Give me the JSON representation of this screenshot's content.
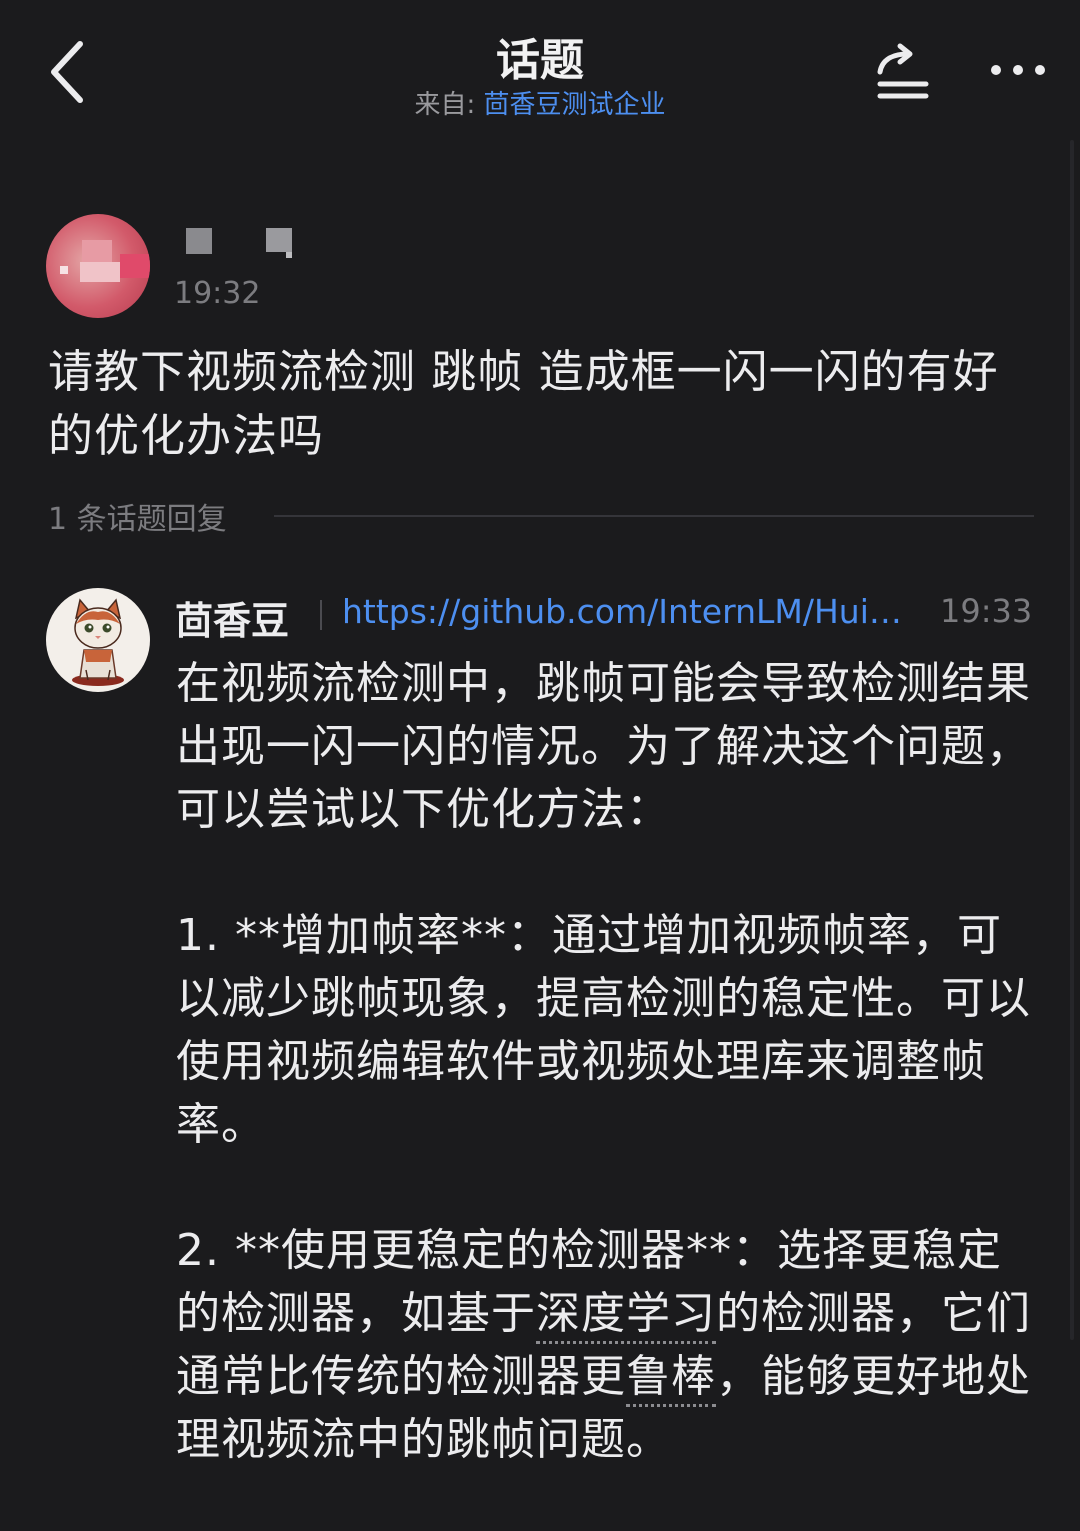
{
  "header": {
    "title": "话题",
    "source_label": "来自: ",
    "source_org": "茴香豆测试企业"
  },
  "post": {
    "time": "19:32",
    "text": "请教下视频流检测 跳帧  造成框一闪一闪的有好的优化办法吗"
  },
  "reply_count": "1 条话题回复",
  "reply": {
    "author": "茴香豆",
    "link": "https://github.com/InternLM/Huixiangdou",
    "time": "19:33",
    "paragraphs": {
      "p1": "在视频流检测中，跳帧可能会导致检测结果出现一闪一闪的情况。为了解决这个问题，可以尝试以下优化方法：",
      "p2": "1. **增加帧率**：通过增加视频帧率，可以减少跳帧现象，提高检测的稳定性。可以使用视频编辑软件或视频处理库来调整帧率。",
      "p3_a": "2. **使用更稳定的检测器**：选择更稳定的检测器，如基于",
      "p3_term1": "深度学习",
      "p3_b": "的检测器，它们通常比传统的检测器更",
      "p3_term2": "鲁棒",
      "p3_c": "，能够更好地处理视频流中的跳帧问题。"
    }
  },
  "icons": {
    "back": "chevron-left-icon",
    "share": "share-icon",
    "more": "more-horizontal-icon"
  },
  "colors": {
    "background": "#1b1b1d",
    "link": "#4d8ff0",
    "muted": "#7c7c80"
  }
}
